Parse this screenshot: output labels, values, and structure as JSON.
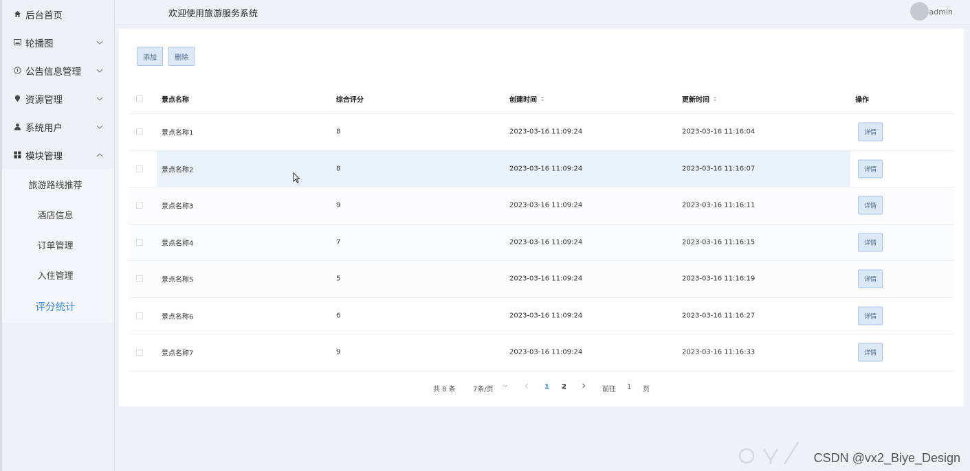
{
  "sidebar": {
    "items": [
      {
        "label": "后台首页",
        "icon": "home-icon",
        "has_chevron": false
      },
      {
        "label": "轮播图",
        "icon": "image-icon",
        "chevron": "down"
      },
      {
        "label": "公告信息管理",
        "icon": "info-icon",
        "chevron": "down"
      },
      {
        "label": "资源管理",
        "icon": "location-icon",
        "chevron": "down"
      },
      {
        "label": "系统用户",
        "icon": "user-icon",
        "chevron": "down"
      },
      {
        "label": "模块管理",
        "icon": "grid-icon",
        "chevron": "up"
      }
    ],
    "submenu": [
      {
        "label": "旅游路线推荐",
        "active": false
      },
      {
        "label": "酒店信息",
        "active": false
      },
      {
        "label": "订单管理",
        "active": false
      },
      {
        "label": "入住管理",
        "active": false
      },
      {
        "label": "评分统计",
        "active": true
      }
    ]
  },
  "header": {
    "title": "欢迎使用旅游服务系统",
    "user": "admin"
  },
  "toolbar": {
    "add_label": "添加",
    "delete_label": "删除"
  },
  "table": {
    "columns": [
      "景点名称",
      "综合评分",
      "创建时间",
      "更新时间",
      "操作"
    ],
    "rows": [
      {
        "name": "景点名称1",
        "score": "8",
        "created": "2023-03-16 11:09:24",
        "updated": "2023-03-16 11:16:04",
        "action": "详情"
      },
      {
        "name": "景点名称2",
        "score": "8",
        "created": "2023-03-16 11:09:24",
        "updated": "2023-03-16 11:16:07",
        "action": "详情"
      },
      {
        "name": "景点名称3",
        "score": "9",
        "created": "2023-03-16 11:09:24",
        "updated": "2023-03-16 11:16:11",
        "action": "详情"
      },
      {
        "name": "景点名称4",
        "score": "7",
        "created": "2023-03-16 11:09:24",
        "updated": "2023-03-16 11:16:15",
        "action": "详情"
      },
      {
        "name": "景点名称5",
        "score": "5",
        "created": "2023-03-16 11:09:24",
        "updated": "2023-03-16 11:16:19",
        "action": "详情"
      },
      {
        "name": "景点名称6",
        "score": "6",
        "created": "2023-03-16 11:09:24",
        "updated": "2023-03-16 11:16:27",
        "action": "详情"
      },
      {
        "name": "景点名称7",
        "score": "9",
        "created": "2023-03-16 11:09:24",
        "updated": "2023-03-16 11:16:33",
        "action": "详情"
      }
    ]
  },
  "pagination": {
    "total": "共 8 条",
    "page_size": "7条/页",
    "pages": [
      "1",
      "2"
    ],
    "current": "1",
    "goto_prefix": "前往",
    "goto_value": "1",
    "goto_suffix": "页"
  },
  "watermark": {
    "text": "CSDN @vx2_Biye_Design"
  },
  "colors": {
    "accent": "#3a8ee6",
    "button_bg": "#dbe8f5",
    "row_hover": "#e9f2fb"
  }
}
